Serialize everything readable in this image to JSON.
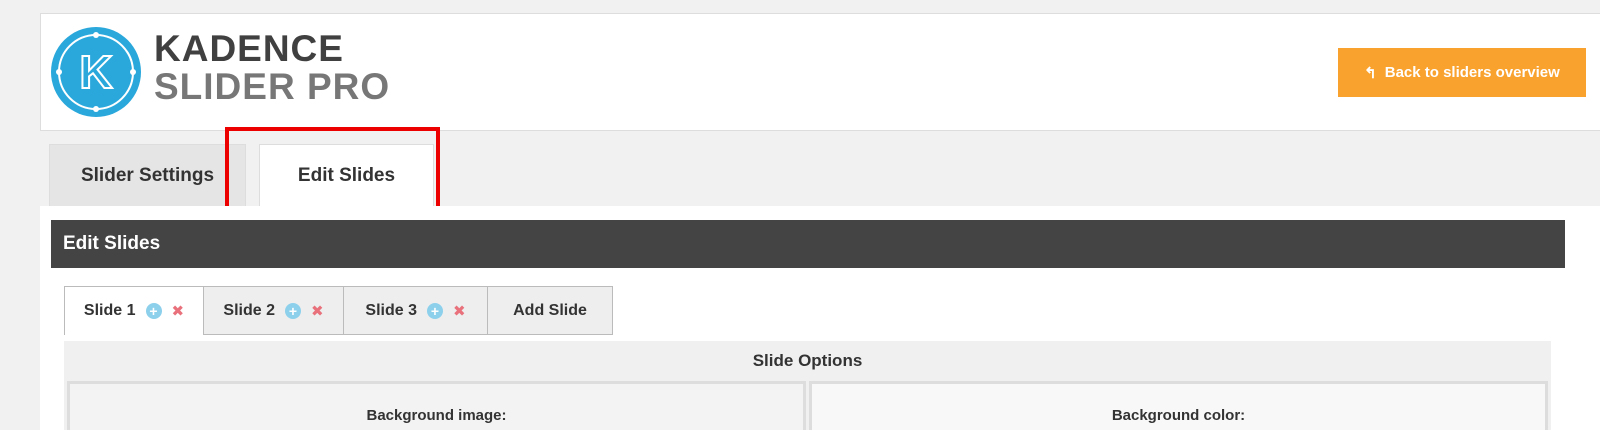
{
  "header": {
    "logo_letter": "K",
    "logo_line1": "KADENCE",
    "logo_line2": "SLIDER PRO",
    "back_button_label": "Back to sliders overview",
    "back_button_icon": "return-arrow-icon",
    "accent_color": "#f9a22e"
  },
  "tabs": [
    {
      "label": "Slider Settings",
      "active": false
    },
    {
      "label": "Edit Slides",
      "active": true
    }
  ],
  "panel": {
    "title": "Edit Slides",
    "slide_tabs": [
      {
        "label": "Slide 1",
        "active": true
      },
      {
        "label": "Slide 2",
        "active": false
      },
      {
        "label": "Slide 3",
        "active": false
      }
    ],
    "add_slide_label": "Add Slide",
    "options_title": "Slide Options",
    "background_image_label": "Background image:",
    "background_color_label": "Background color:"
  }
}
